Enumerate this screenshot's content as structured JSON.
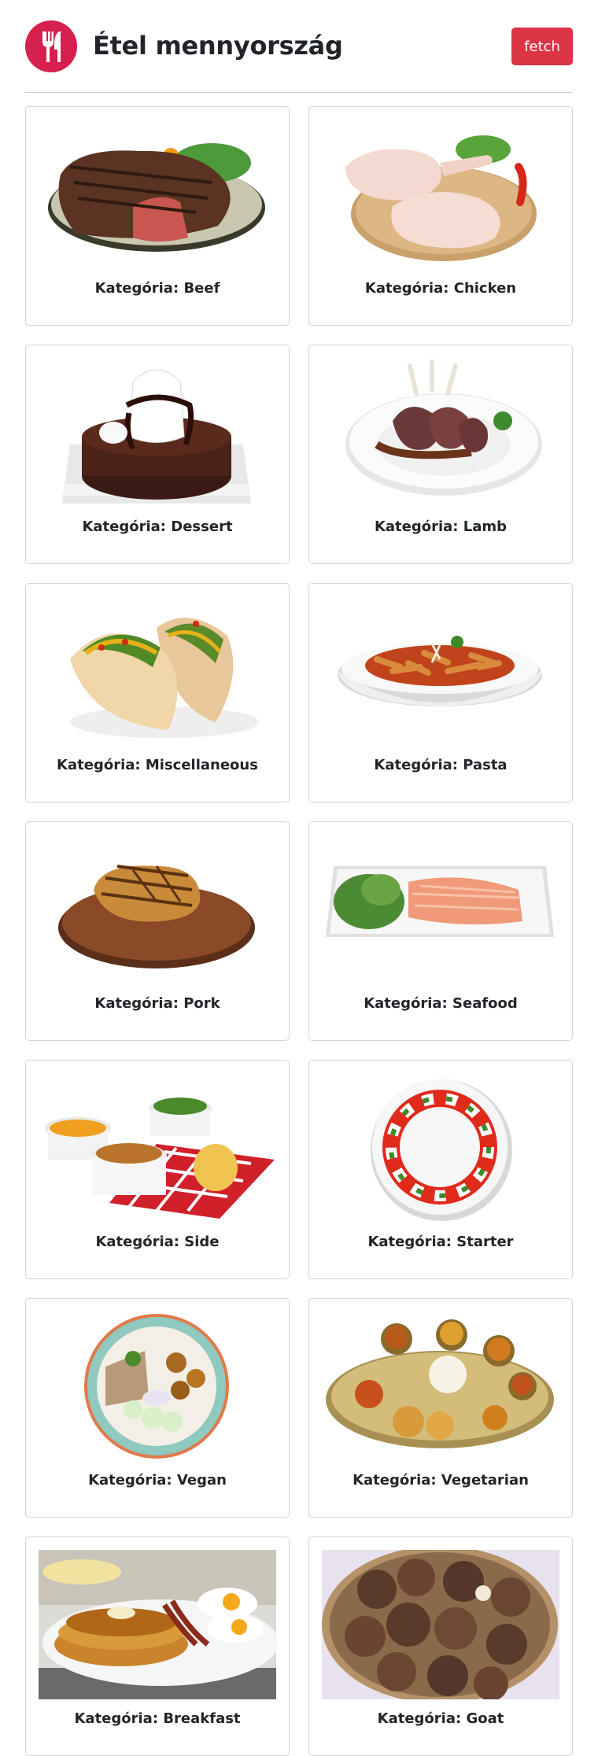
{
  "header": {
    "logo_icon": "fork-knife-icon",
    "title": "Étel mennyország",
    "fetch_label": "fetch",
    "accent_color": "#dc3545",
    "logo_color": "#d6204d"
  },
  "card_prefix": "Kategória:",
  "categories": [
    {
      "name": "Beef",
      "image": "steak-image"
    },
    {
      "name": "Chicken",
      "image": "chicken-legs-image"
    },
    {
      "name": "Dessert",
      "image": "chocolate-cake-image"
    },
    {
      "name": "Lamb",
      "image": "lamb-chops-image"
    },
    {
      "name": "Miscellaneous",
      "image": "tacos-image"
    },
    {
      "name": "Pasta",
      "image": "penne-pasta-image"
    },
    {
      "name": "Pork",
      "image": "pork-chop-image"
    },
    {
      "name": "Seafood",
      "image": "salmon-platter-image"
    },
    {
      "name": "Side",
      "image": "side-dishes-image"
    },
    {
      "name": "Starter",
      "image": "caprese-wreath-image"
    },
    {
      "name": "Vegan",
      "image": "vegan-bowl-image"
    },
    {
      "name": "Vegetarian",
      "image": "thali-platter-image"
    },
    {
      "name": "Breakfast",
      "image": "pancakes-eggs-image"
    },
    {
      "name": "Goat",
      "image": "goat-stew-image"
    }
  ]
}
